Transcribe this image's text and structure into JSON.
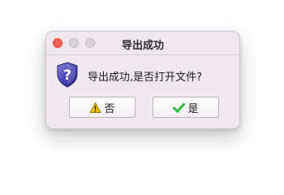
{
  "dialog": {
    "title": "导出成功",
    "message": "导出成功,是否打开文件?",
    "icon": "question-shield-icon"
  },
  "buttons": {
    "no": {
      "label": "否",
      "icon": "warning-icon"
    },
    "yes": {
      "label": "是",
      "icon": "checkmark-icon"
    }
  },
  "window_controls": {
    "close_color": "#fe5f57",
    "inactive_color": "#d7d1d8"
  }
}
